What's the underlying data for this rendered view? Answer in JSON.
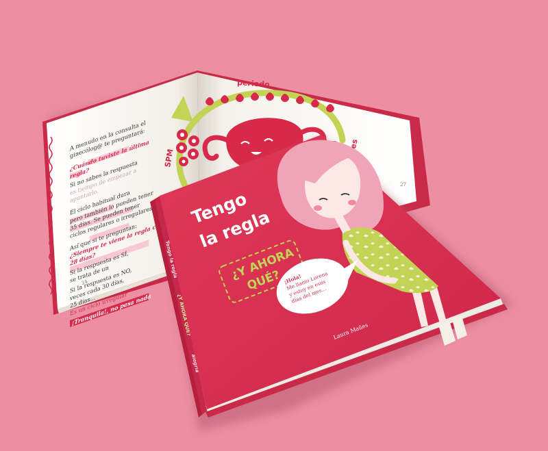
{
  "cover": {
    "title_line1": "Tengo",
    "title_line2": "la regla",
    "subtitle_line1": "¿Y AHORA",
    "subtitle_line2": "QUÉ?",
    "speech_line1": "¡Hola!",
    "speech_line2": "Me llamo Lorena",
    "speech_line3": "y estoy en esos",
    "speech_line4": "días del mes...",
    "author": "Laura Mañes"
  },
  "spine": {
    "title": "Tengo la regla",
    "subtitle": "¿Y AHORA QUÉ?",
    "publisher": "alegría"
  },
  "left_page": {
    "lines": [
      "A menudo en la consulta el",
      "ginecólog@ te preguntará:",
      "¿Cuándo tuviste la última",
      "regla?",
      "Si no sabes la respuesta",
      "es tiempo de empezar a",
      "apuntarlo.",
      "El ciclo habitual dura",
      "pero también lo pueden tener",
      "35 días. Se pueden tener",
      "ciclos regulares o irregulares.",
      "Así que si te preguntan:",
      "¿Siempre te viene la regla cada",
      "28 días?",
      "Si la respuesta es SÍ,",
      "se trata de un",
      "Si la respuesta es NO,",
      "veces cada 30 días,",
      "25 días...",
      "Es un ciclo irregular",
      "¡Tranquila!, no pasa nada"
    ],
    "page_number": "24"
  },
  "right_page": {
    "label_top": "periodo",
    "label_left": "SPM",
    "label_right": "Fértiles",
    "page_number": "27"
  },
  "colors": {
    "background": "#ec8fa3",
    "cover_red": "#d8304f",
    "ink_red": "#d72a4a",
    "lime": "#c3d356",
    "cream": "#f4f0e8",
    "skin": "#fbe8e4",
    "hair_pink": "#f0a4b8"
  }
}
